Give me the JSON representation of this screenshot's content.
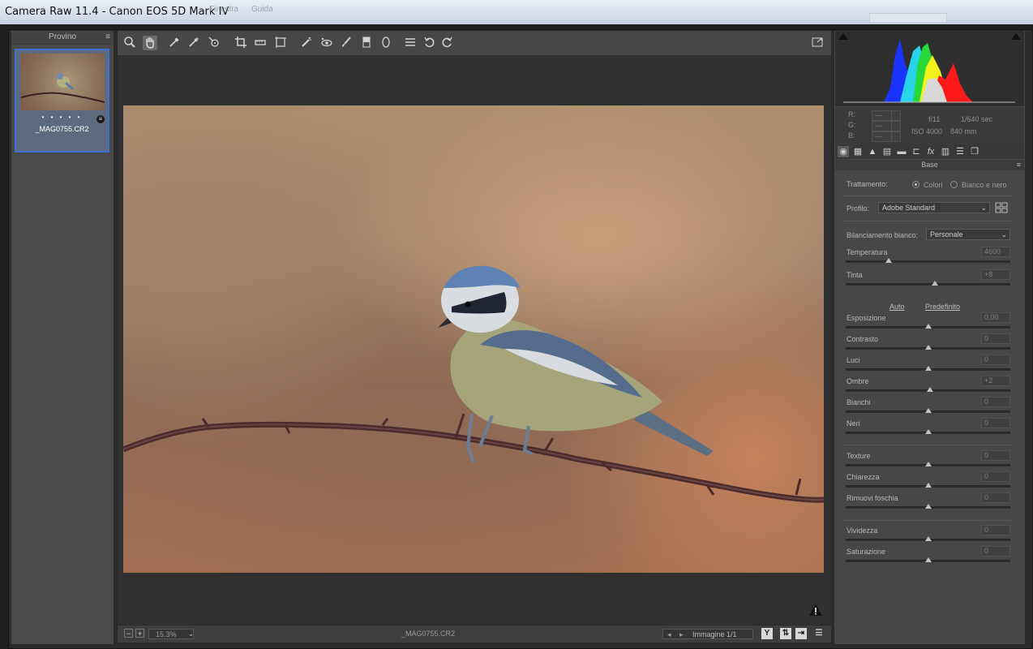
{
  "window": {
    "title": "Camera Raw 11.4  -  Canon EOS 5D Mark IV",
    "ghost_menu": [
      "Finestra",
      "Guida"
    ]
  },
  "filmstrip": {
    "header": "Provino",
    "items": [
      {
        "filename": "_MAG0755.CR2",
        "rating_dots": "• • • • •"
      }
    ]
  },
  "toolbar": {
    "tools": [
      {
        "name": "zoom-tool-icon",
        "glyph": "⌕"
      },
      {
        "name": "hand-tool-icon",
        "glyph": "✋"
      },
      {
        "name": "white-balance-tool-icon",
        "glyph": "⁄"
      },
      {
        "name": "color-sampler-tool-icon",
        "glyph": "⁄"
      },
      {
        "name": "targeted-adjustment-tool-icon",
        "glyph": "⊙"
      },
      {
        "name": "crop-tool-icon",
        "glyph": "⌗"
      },
      {
        "name": "straighten-tool-icon",
        "glyph": "▭"
      },
      {
        "name": "transform-tool-icon",
        "glyph": "⊞"
      },
      {
        "name": "spot-removal-tool-icon",
        "glyph": "✎"
      },
      {
        "name": "red-eye-tool-icon",
        "glyph": "◉"
      },
      {
        "name": "adjustment-brush-icon",
        "glyph": "⁄"
      },
      {
        "name": "graduated-filter-icon",
        "glyph": "▮"
      },
      {
        "name": "radial-filter-icon",
        "glyph": "◯"
      },
      {
        "name": "preferences-icon",
        "glyph": "≡"
      },
      {
        "name": "rotate-left-icon",
        "glyph": "↺"
      },
      {
        "name": "rotate-right-icon",
        "glyph": "↻"
      }
    ],
    "fullscreen_icon": "⇱"
  },
  "status": {
    "zoom": "15.3%",
    "filename": "_MAG0755.CR2",
    "image_counter": "Immagine 1/1",
    "buttons": [
      "Y"
    ]
  },
  "camera_info": {
    "r_label": "R:",
    "g_label": "G:",
    "b_label": "B:",
    "r_val": "---",
    "g_val": "---",
    "b_val": "---",
    "aperture": "f/11",
    "shutter": "1/640 sec",
    "iso": "ISO 4000",
    "focal": "840 mm"
  },
  "panel": {
    "section_title": "Base",
    "trattamento_label": "Trattamento:",
    "trattamento_options": [
      "Colori",
      "Bianco e nero"
    ],
    "trattamento_selected": "Colori",
    "profilo_label": "Profilo:",
    "profilo_value": "Adobe Standard",
    "wb_label": "Bilanciamento bianco:",
    "wb_value": "Personale",
    "auto_link": "Auto",
    "default_link": "Predefinito",
    "sliders": [
      {
        "label": "Temperatura",
        "value": "4600",
        "position": 0.26
      },
      {
        "label": "Tinta",
        "value": "+8",
        "position": 0.54
      },
      {
        "label": "Esposizione",
        "value": "0,00",
        "position": 0.5
      },
      {
        "label": "Contrasto",
        "value": "0",
        "position": 0.5
      },
      {
        "label": "Luci",
        "value": "0",
        "position": 0.5
      },
      {
        "label": "Ombre",
        "value": "+2",
        "position": 0.51
      },
      {
        "label": "Bianchi",
        "value": "0",
        "position": 0.5
      },
      {
        "label": "Neri",
        "value": "0",
        "position": 0.5
      },
      {
        "label": "Texture",
        "value": "0",
        "position": 0.5
      },
      {
        "label": "Chiarezza",
        "value": "0",
        "position": 0.5
      },
      {
        "label": "Rimuovi foschia",
        "value": "0",
        "position": 0.5
      },
      {
        "label": "Vividezza",
        "value": "0",
        "position": 0.5
      },
      {
        "label": "Saturazione",
        "value": "0",
        "position": 0.5
      }
    ]
  },
  "colors": {
    "accent_selection": "#3b6fd0",
    "panel_bg": "#474747",
    "histogram_red": "#ff1a1a",
    "histogram_green": "#27d83a",
    "histogram_blue": "#1a33ff",
    "histogram_yellow": "#f2f21a",
    "histogram_cyan": "#28d5e8"
  }
}
